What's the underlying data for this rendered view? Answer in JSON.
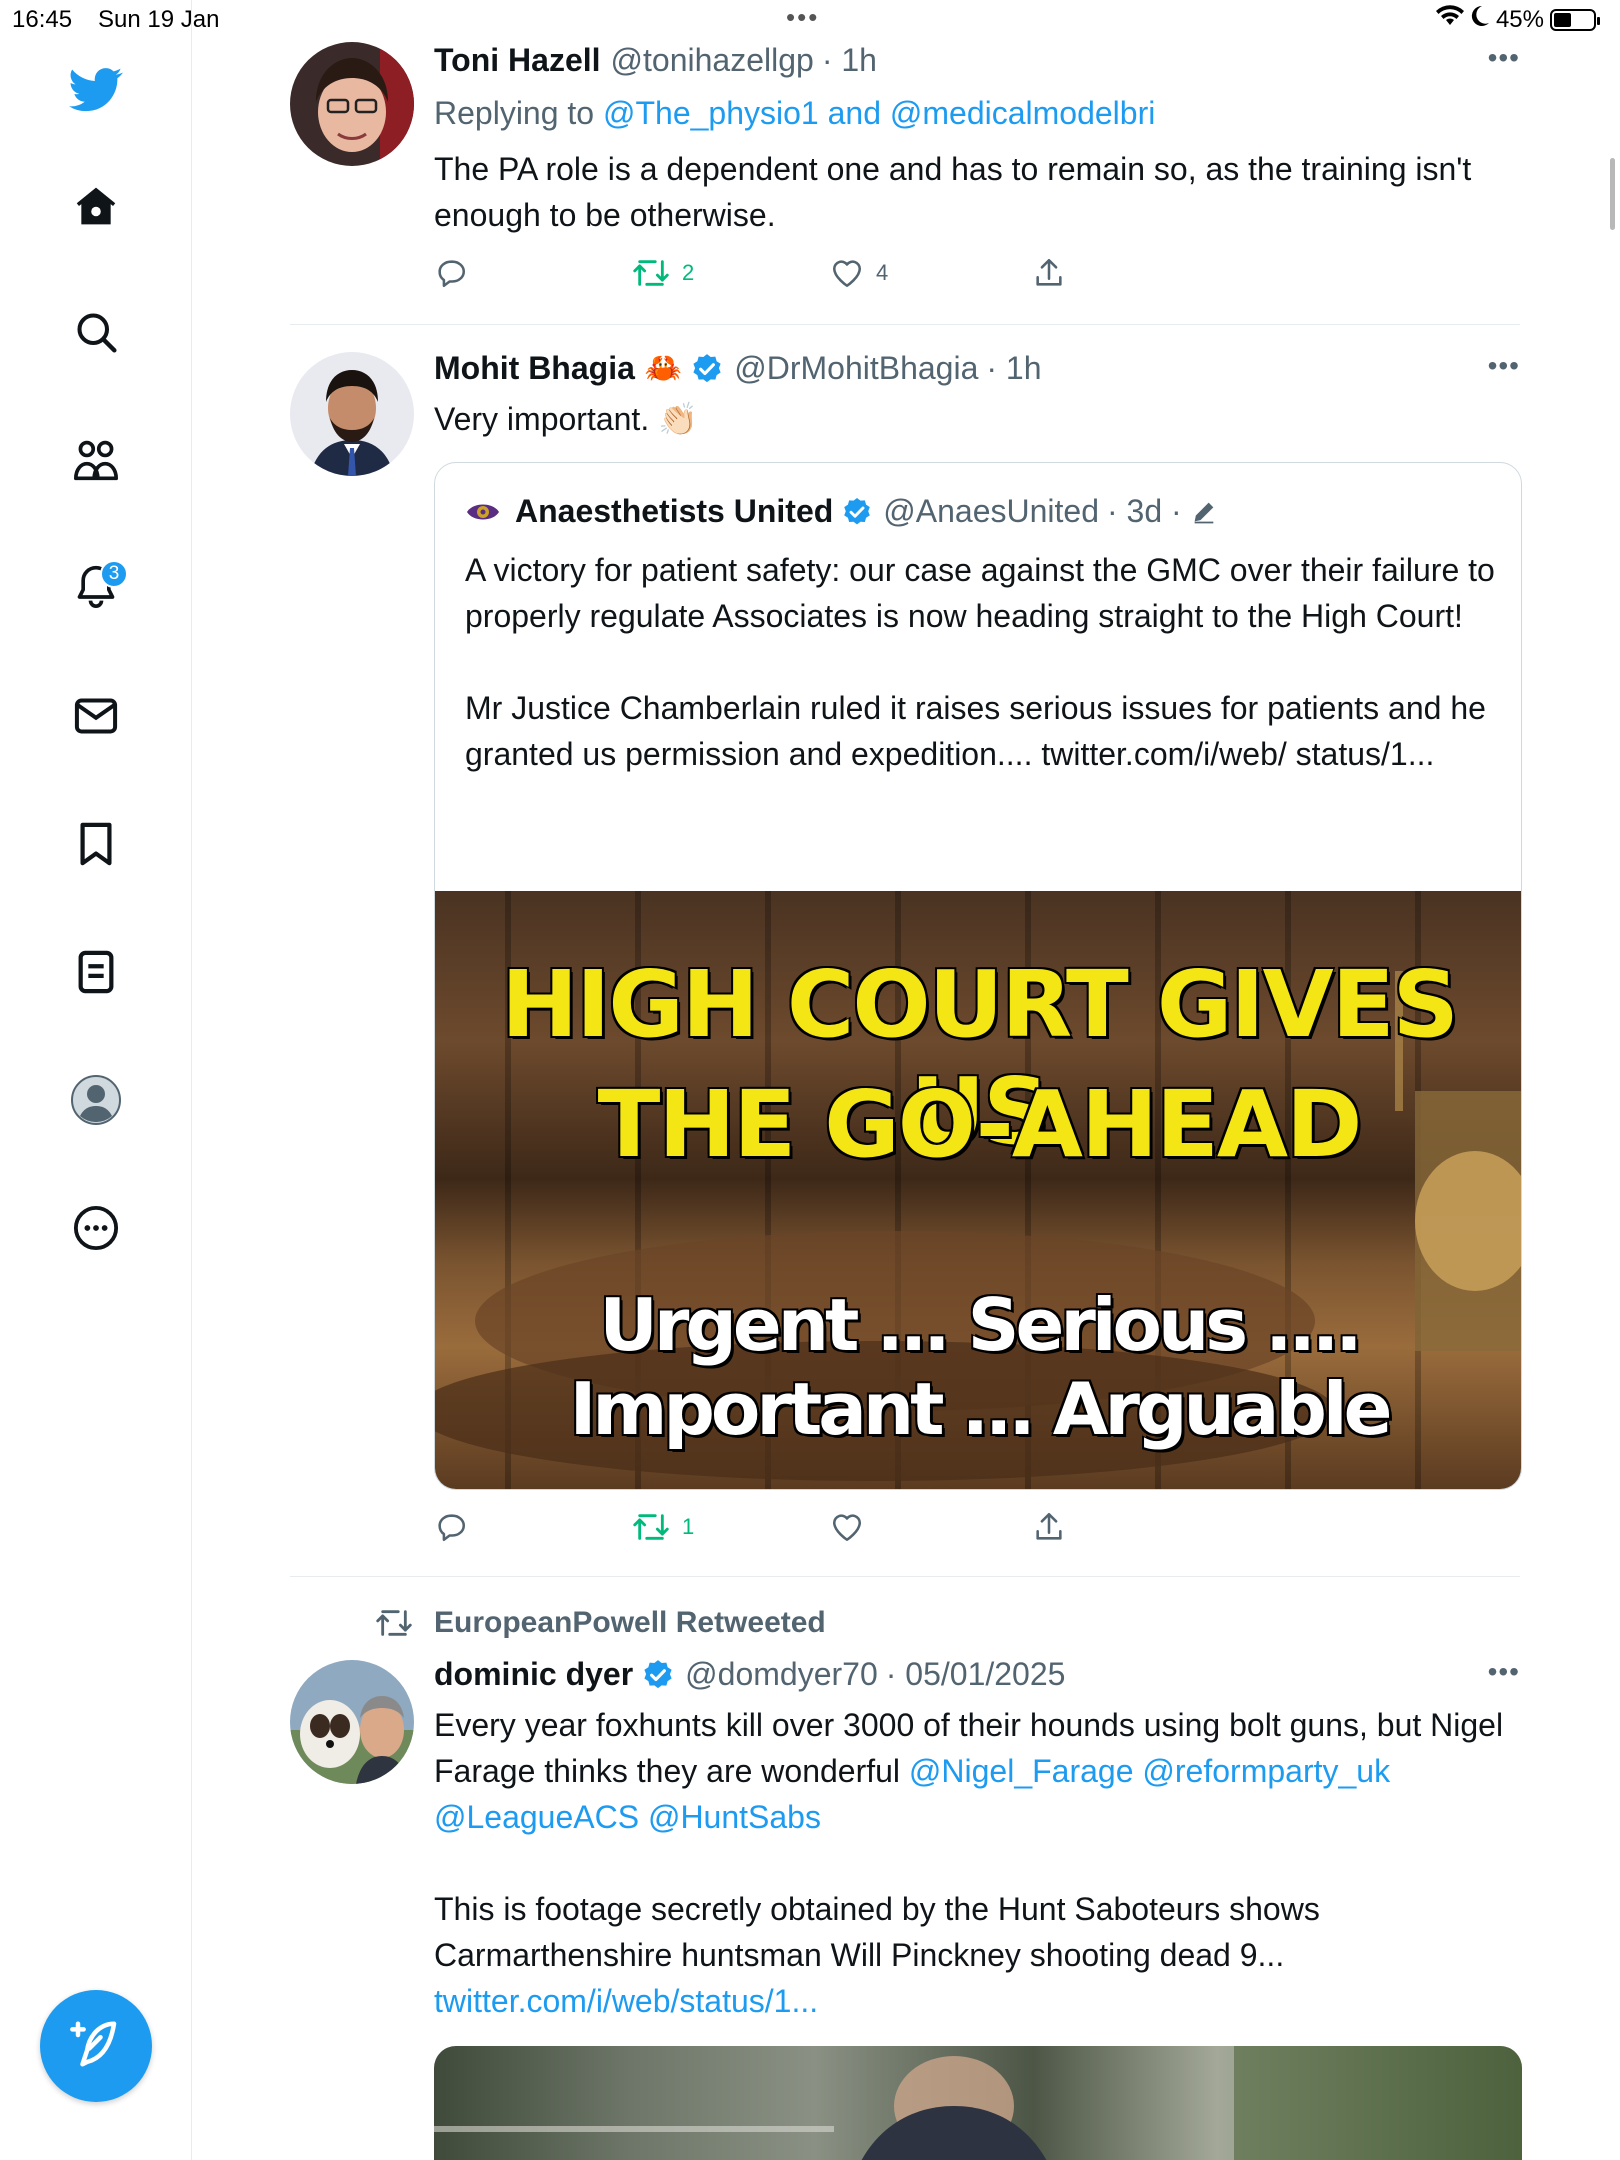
{
  "status_bar": {
    "time": "16:45",
    "date": "Sun 19 Jan",
    "battery": "45%",
    "battery_fraction": 0.45
  },
  "sidebar": {
    "notifications_badge": "3"
  },
  "tweets": [
    {
      "name": "Toni Hazell",
      "handle": "@tonihazellgp",
      "time": "· 1h",
      "replying_prefix": "Replying to",
      "replying_to": "@The_physio1 and @medicalmodelbri",
      "text": "The PA role is a dependent one and has to remain so, as the training isn't enough to be otherwise.",
      "retweets": "2",
      "likes": "4"
    },
    {
      "name": "Mohit Bhagia",
      "name_emoji": "🦀",
      "handle": "@DrMohitBhagia",
      "time": "· 1h",
      "text": "Very important. 👏🏻",
      "retweets": "1",
      "quote": {
        "name": "Anaesthetists United",
        "handle": "@AnaesUnited",
        "time": "· 3d ·",
        "text_1": "A victory for patient safety: our case against the GMC over their failure to properly regulate Associates is now heading straight to the High Court!",
        "text_2": "Mr Justice Chamberlain ruled it raises serious issues for patients and he granted us permission and expedition.... twitter.com/i/web/ status/1...",
        "image_headline_1": "HIGH COURT GIVES US",
        "image_headline_2": "THE GO-AHEAD",
        "image_sub_1": "Urgent ... Serious ....",
        "image_sub_2": "Important ... Arguable"
      }
    },
    {
      "retweeted_by": "EuropeanPowell Retweeted",
      "name": "dominic dyer",
      "handle": "@domdyer70",
      "time": "· 05/01/2025",
      "text_1": "Every year foxhunts kill over 3000 of their hounds using bolt guns, but Nigel Farage thinks they are wonderful",
      "mention_1": "@Nigel_Farage",
      "mention_2": "@reformparty_uk",
      "mention_3": "@LeagueACS",
      "mention_4": "@HuntSabs",
      "text_2": "This is footage secretly obtained by the Hunt Saboteurs shows Carmarthenshire huntsman Will Pinckney shooting dead 9...",
      "link": "twitter.com/i/web/status/1..."
    }
  ],
  "colors": {
    "accent": "#1d9bf0",
    "retweet": "#00ba7c",
    "secondary_text": "#536471"
  }
}
